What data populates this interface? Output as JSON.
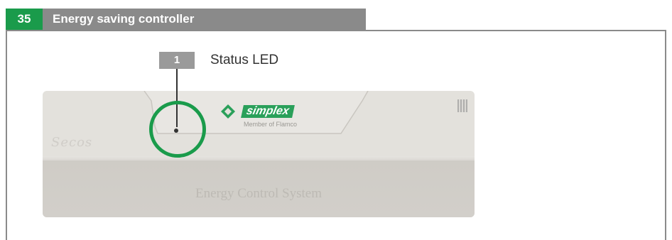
{
  "header": {
    "number": "35",
    "title": "Energy saving controller"
  },
  "callout": {
    "number": "1",
    "label": "Status LED"
  },
  "device": {
    "model": "Secos",
    "brand": "simplex",
    "brand_tagline": "Member of Flamco",
    "product_line": "Energy Control System"
  },
  "colors": {
    "accent_green": "#1a9b4b",
    "header_gray": "#8a8a8a"
  }
}
